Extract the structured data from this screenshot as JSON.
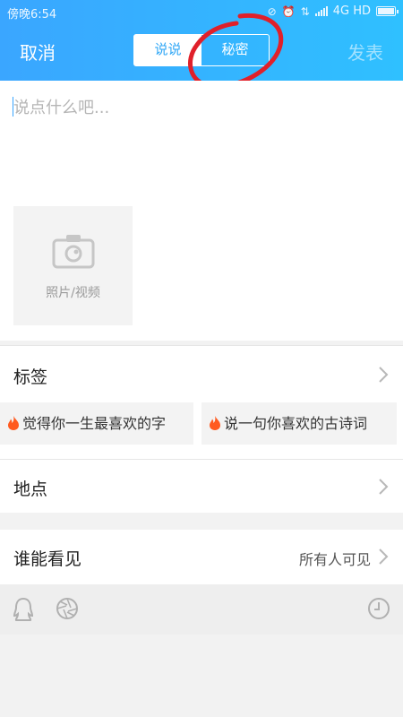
{
  "status_bar": {
    "time": "傍晚6:54",
    "network": "4G HD"
  },
  "header": {
    "cancel_label": "取消",
    "publish_label": "发表",
    "tabs": [
      {
        "label": "说说",
        "active": true
      },
      {
        "label": "秘密",
        "active": false
      }
    ]
  },
  "compose": {
    "placeholder": "说点什么吧...",
    "media_label": "照片/视频"
  },
  "tags_section": {
    "title": "标签",
    "suggestions": [
      "觉得你一生最喜欢的字",
      "说一句你喜欢的古诗词"
    ]
  },
  "location": {
    "title": "地点"
  },
  "visibility": {
    "title": "谁能看见",
    "value": "所有人可见"
  },
  "colors": {
    "accent": "#2ea6f6",
    "annotation": "#e0202a",
    "flame": "#ff5a1f"
  }
}
